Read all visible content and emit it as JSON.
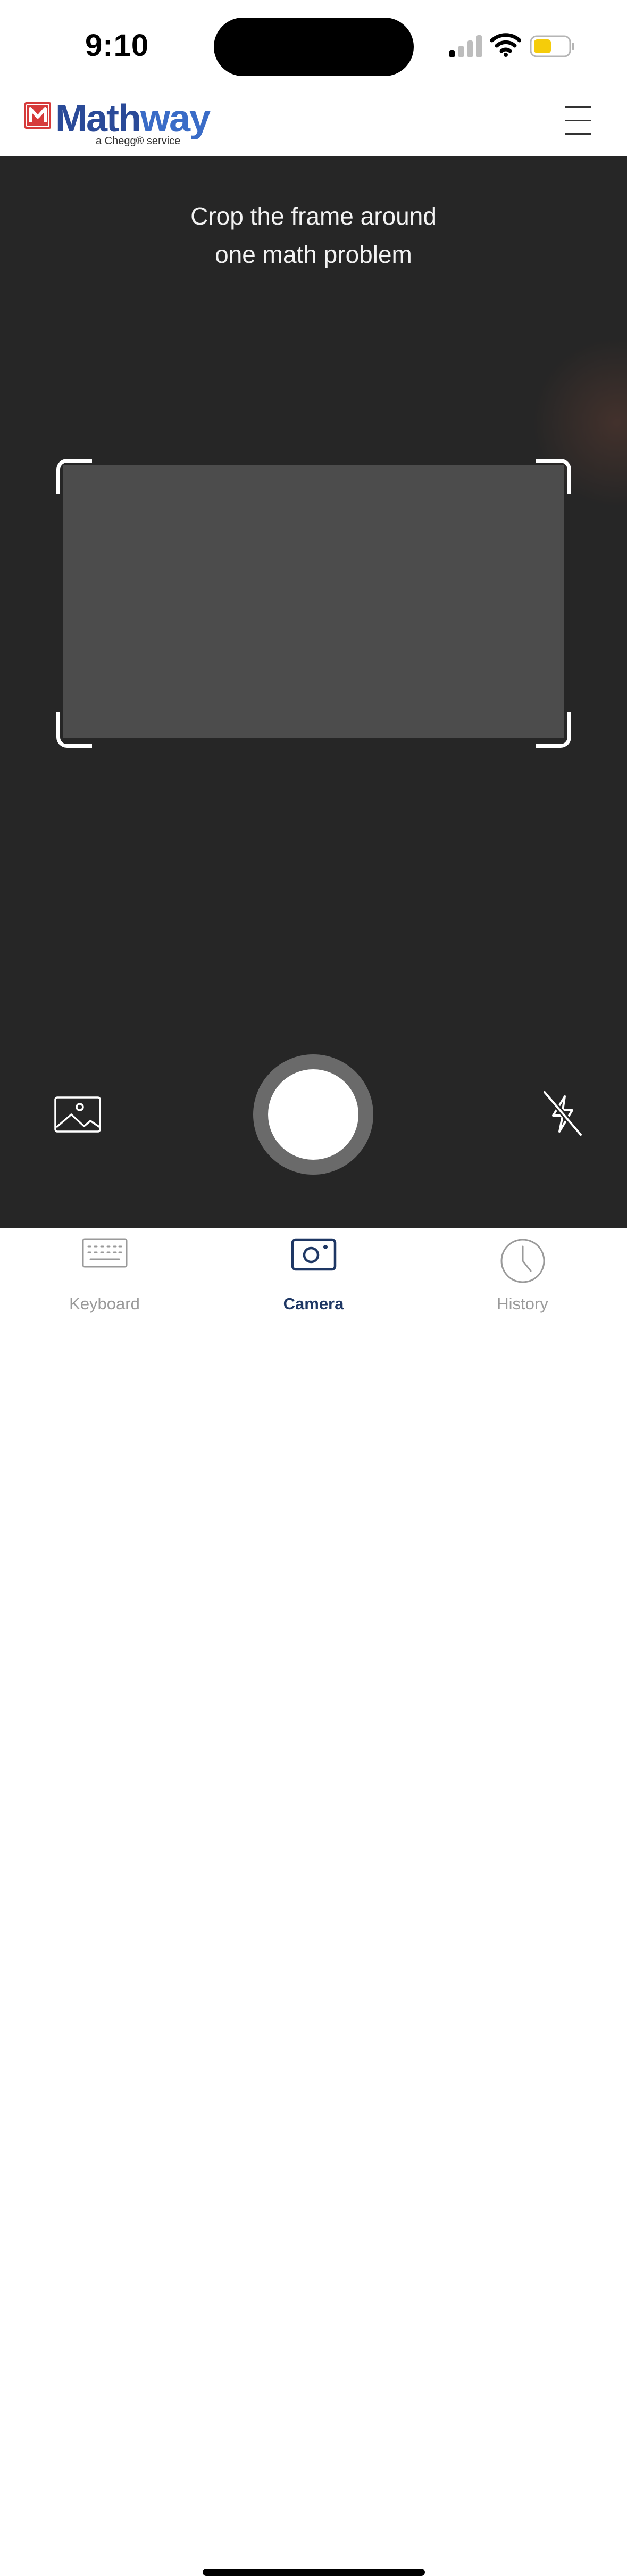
{
  "status_bar": {
    "time": "9:10",
    "icons": [
      "signal-icon",
      "wifi-icon",
      "battery-icon"
    ],
    "battery_color": "#f5cc0a"
  },
  "header": {
    "brand_prefix": "Math",
    "brand_suffix": "way",
    "brand_sub": "a Chegg® service",
    "icons": [
      "mathway-logo-icon",
      "menu-icon"
    ],
    "colors": {
      "brand": "#2a4a98",
      "logo_red": "#d63a3a"
    }
  },
  "camera": {
    "instruction_line1": "Crop the frame around",
    "instruction_line2": "one math problem",
    "icons": [
      "gallery-icon",
      "shutter-button",
      "flash-off-icon"
    ]
  },
  "tabs": [
    {
      "label": "Keyboard",
      "icon": "keyboard-icon",
      "active": false
    },
    {
      "label": "Camera",
      "icon": "camera-icon",
      "active": true
    },
    {
      "label": "History",
      "icon": "clock-icon",
      "active": false
    }
  ],
  "colors": {
    "active_tab": "#1e3764",
    "inactive_tab": "#9a9a9a",
    "camera_bg": "#262626"
  }
}
